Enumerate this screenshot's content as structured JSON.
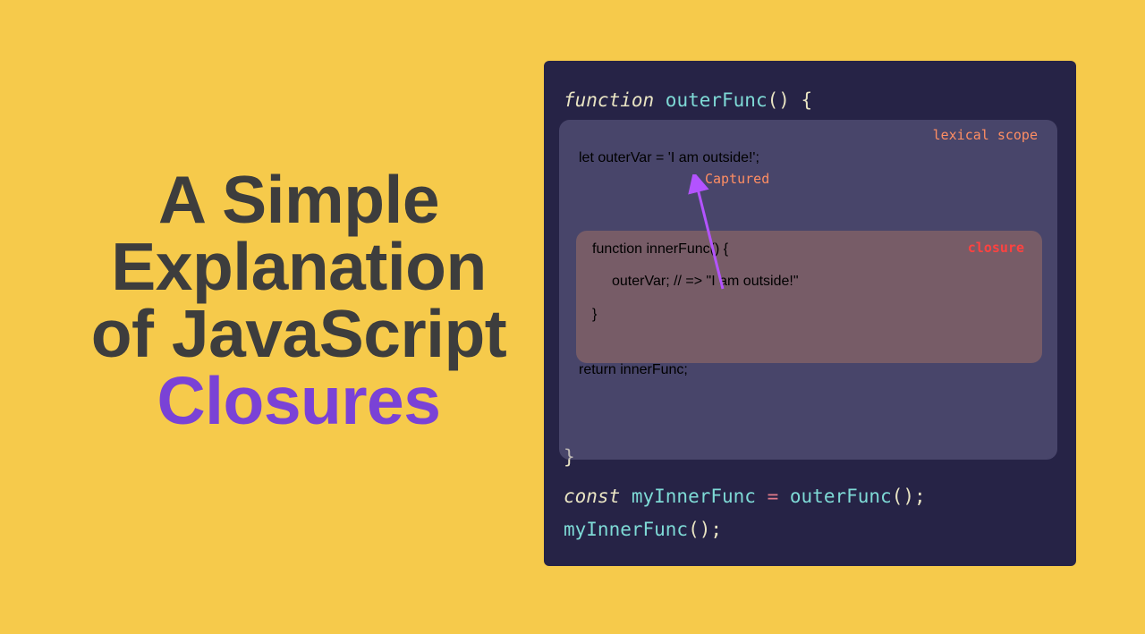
{
  "title": {
    "line1": "A Simple",
    "line2": "Explanation",
    "line3": "of JavaScript",
    "accent": "Closures"
  },
  "labels": {
    "lexical_scope": "lexical scope",
    "closure": "closure",
    "captured": "Captured"
  },
  "code": {
    "l1_function": "function",
    "l1_outerFunc": " outerFunc",
    "l1_open": "() {",
    "l2_let": "let",
    "l2_outerVar": " outerVar ",
    "l2_eq": "=",
    "l2_str": " 'I am outside!'",
    "l2_semi": ";",
    "l3_function": "function",
    "l3_innerFunc": " innerFunc",
    "l3_open": "() {",
    "l4_outerVar": "outerVar",
    "l4_semi": "; ",
    "l4_cmt": "// => \"I am outside!\"",
    "l5_close": "}",
    "l6_return": "return",
    "l6_innerFunc": " innerFunc",
    "l6_semi": ";",
    "l7_close": "}",
    "l8_const": "const",
    "l8_myInnerFunc": " myInnerFunc ",
    "l8_eq": "=",
    "l8_outerFunc": " outerFunc",
    "l8_call": "();",
    "l9_myInnerFunc": "myInnerFunc",
    "l9_call": "();"
  }
}
